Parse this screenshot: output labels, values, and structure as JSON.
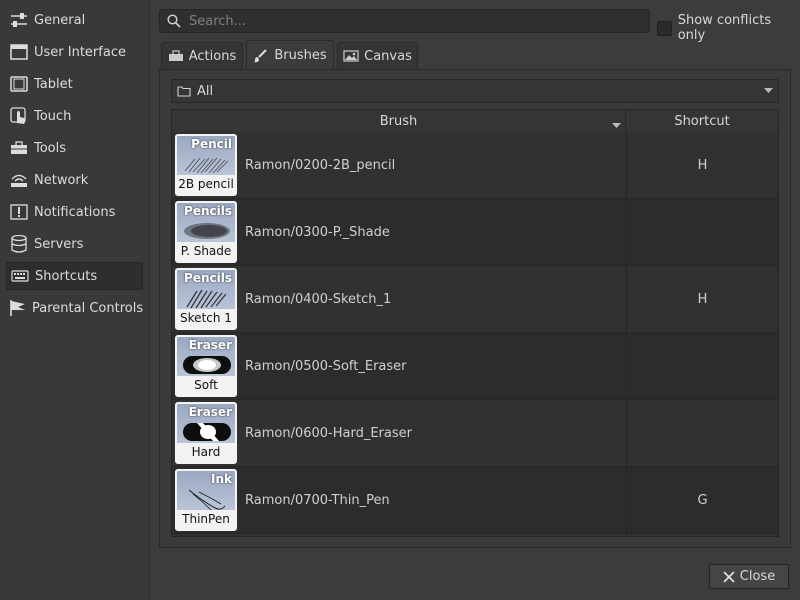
{
  "sidebar": {
    "items": [
      {
        "label": "General",
        "icon": "sliders-icon"
      },
      {
        "label": "User Interface",
        "icon": "window-icon"
      },
      {
        "label": "Tablet",
        "icon": "tablet-icon"
      },
      {
        "label": "Touch",
        "icon": "touch-icon"
      },
      {
        "label": "Tools",
        "icon": "toolbox-icon"
      },
      {
        "label": "Network",
        "icon": "network-icon"
      },
      {
        "label": "Notifications",
        "icon": "notification-icon"
      },
      {
        "label": "Servers",
        "icon": "database-icon"
      },
      {
        "label": "Shortcuts",
        "icon": "keyboard-icon",
        "active": true
      },
      {
        "label": "Parental Controls",
        "icon": "flag-icon"
      }
    ]
  },
  "search": {
    "placeholder": "Search...",
    "value": ""
  },
  "conflicts": {
    "label": "Show conflicts only",
    "checked": false
  },
  "tabs": [
    {
      "label": "Actions",
      "icon": "toolbox-icon"
    },
    {
      "label": "Brushes",
      "icon": "brush-icon",
      "active": true
    },
    {
      "label": "Canvas",
      "icon": "image-icon"
    }
  ],
  "filter": {
    "selected": "All",
    "icon": "folder-icon"
  },
  "table": {
    "headers": {
      "brush": "Brush",
      "shortcut": "Shortcut"
    },
    "rows": [
      {
        "category": "Pencil",
        "label": "2B pencil",
        "name": "Ramon/0200-2B_pencil",
        "shortcut": "H",
        "mark": "pencil"
      },
      {
        "category": "Pencils",
        "label": "P. Shade",
        "name": "Ramon/0300-P._Shade",
        "shortcut": "",
        "mark": "shade"
      },
      {
        "category": "Pencils",
        "label": "Sketch 1",
        "name": "Ramon/0400-Sketch_1",
        "shortcut": "H",
        "mark": "sketch"
      },
      {
        "category": "Eraser",
        "label": "Soft",
        "name": "Ramon/0500-Soft_Eraser",
        "shortcut": "",
        "mark": "soft-eraser"
      },
      {
        "category": "Eraser",
        "label": "Hard",
        "name": "Ramon/0600-Hard_Eraser",
        "shortcut": "",
        "mark": "hard-eraser"
      },
      {
        "category": "Ink",
        "label": "ThinPen",
        "name": "Ramon/0700-Thin_Pen",
        "shortcut": "G",
        "mark": "ink"
      }
    ]
  },
  "footer": {
    "close_label": "Close"
  },
  "colors": {
    "background": "#3c3c3c",
    "sidebar": "#393939",
    "active_item": "#2e2e2e",
    "thumb_gradient": "#9aa8c2"
  }
}
